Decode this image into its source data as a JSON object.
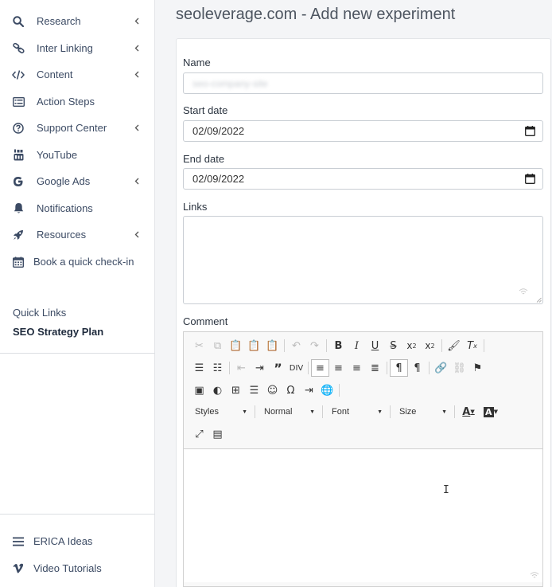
{
  "sidebar": {
    "items": [
      {
        "label": "Research",
        "icon": "search-icon",
        "chevron": true
      },
      {
        "label": "Inter Linking",
        "icon": "link-icon",
        "chevron": true
      },
      {
        "label": "Content",
        "icon": "code-icon",
        "chevron": true
      },
      {
        "label": "Action Steps",
        "icon": "list-icon",
        "chevron": false
      },
      {
        "label": "Support Center",
        "icon": "question-icon",
        "chevron": true
      },
      {
        "label": "YouTube",
        "icon": "youtube-icon",
        "chevron": false
      },
      {
        "label": "Google Ads",
        "icon": "google-icon",
        "chevron": true
      },
      {
        "label": "Notifications",
        "icon": "bell-icon",
        "chevron": false
      },
      {
        "label": "Resources",
        "icon": "rocket-icon",
        "chevron": true
      },
      {
        "label": "Book a quick check-in",
        "icon": "calendar-icon",
        "chevron": false
      }
    ],
    "quick_links_title": "Quick Links",
    "quick_links": [
      "SEO Strategy Plan"
    ],
    "footer": [
      {
        "label": "ERICA Ideas",
        "icon": "menu-icon"
      },
      {
        "label": "Video Tutorials",
        "icon": "vimeo-icon"
      }
    ]
  },
  "page": {
    "title": "seoleverage.com - Add new experiment"
  },
  "form": {
    "name_label": "Name",
    "name_value": "seo-company-site",
    "start_label": "Start date",
    "start_value": "02/09/2022",
    "end_label": "End date",
    "end_value": "02/09/2022",
    "links_label": "Links",
    "comment_label": "Comment"
  },
  "editor": {
    "combos": {
      "styles": "Styles",
      "format": "Normal",
      "font": "Font",
      "size": "Size"
    }
  },
  "colors": {
    "sidebar_text": "#3c4b64",
    "icon": "#3c4b64",
    "border": "#c9ced4"
  }
}
